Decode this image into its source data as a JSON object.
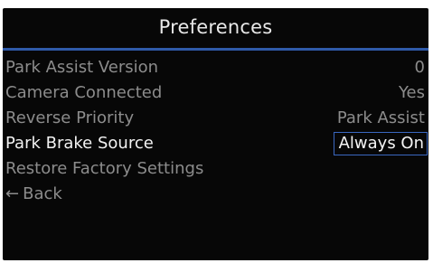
{
  "header": {
    "title": "Preferences"
  },
  "menu": {
    "items": [
      {
        "label": "Park Assist Version",
        "value": "0"
      },
      {
        "label": "Camera Connected",
        "value": "Yes"
      },
      {
        "label": "Reverse Priority",
        "value": "Park Assist"
      },
      {
        "label": "Park Brake Source",
        "value": "Always On"
      },
      {
        "label": "Restore Factory Settings"
      }
    ],
    "back": {
      "arrow": "←",
      "label": "Back"
    }
  },
  "colors": {
    "background": "#070707",
    "accent": "#2f5aa8",
    "inactive_text": "#8c8c8c",
    "active_text": "#f2f2f2"
  }
}
